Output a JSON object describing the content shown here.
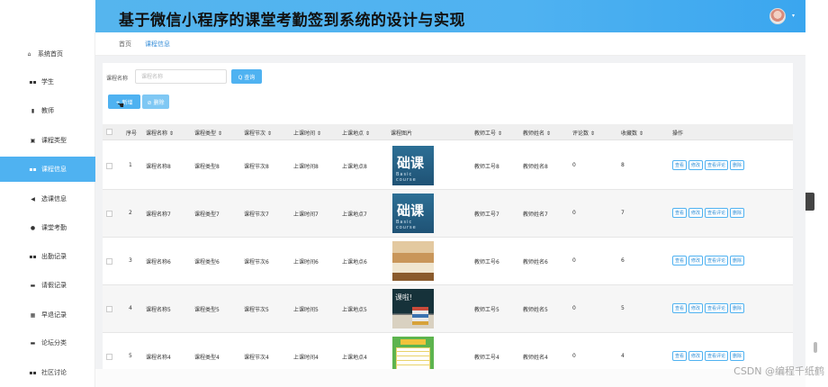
{
  "header": {
    "title": "基于微信小程序的课堂考勤签到系统的设计与实现",
    "caret": "▾"
  },
  "sidebar": {
    "items": [
      {
        "label": "系统首页",
        "icon": "home-icon",
        "glyph": "⌂"
      },
      {
        "label": "学生",
        "icon": "grid-icon",
        "glyph": "▪▪"
      },
      {
        "label": "教师",
        "icon": "chart-icon",
        "glyph": "▮"
      },
      {
        "label": "课程类型",
        "icon": "calendar-icon",
        "glyph": "▣"
      },
      {
        "label": "课程信息",
        "icon": "grid-icon",
        "glyph": "▪▪",
        "active": true
      },
      {
        "label": "选课信息",
        "icon": "send-icon",
        "glyph": "◀"
      },
      {
        "label": "课堂考勤",
        "icon": "location-icon",
        "glyph": "●"
      },
      {
        "label": "出勤记录",
        "icon": "grid-icon",
        "glyph": "▪▪"
      },
      {
        "label": "请假记录",
        "icon": "comment-icon",
        "glyph": "▬"
      },
      {
        "label": "早退记录",
        "icon": "table-icon",
        "glyph": "▦"
      },
      {
        "label": "论坛分类",
        "icon": "comment-icon",
        "glyph": "▬"
      },
      {
        "label": "社区讨论",
        "icon": "grid-icon",
        "glyph": "▪▪"
      }
    ]
  },
  "breadcrumb": {
    "home": "首页",
    "current": "课程信息"
  },
  "search": {
    "label": "课程名称",
    "placeholder": "课程名称",
    "query_label": "Q 查询"
  },
  "toolbar": {
    "add_label": "+ 新增",
    "delete_label": "⊘ 删除"
  },
  "table": {
    "headers": [
      "序号",
      "课程名称 ⇕",
      "课程类型 ⇕",
      "课程节次 ⇕",
      "上课时间 ⇕",
      "上课地点 ⇕",
      "课程图片",
      "教师工号 ⇕",
      "教师姓名 ⇕",
      "评论数 ⇕",
      "收藏数 ⇕",
      "操作"
    ],
    "actions": [
      "查看",
      "修改",
      "查看评论",
      "删除"
    ],
    "rows": [
      {
        "index": "1",
        "name": "课程名称8",
        "type": "课程类型8",
        "section": "课程节次8",
        "time": "上课时间8",
        "place": "上课地点8",
        "image": "blue",
        "image_text": "础课",
        "image_sub": "Basic course",
        "teacher_no": "教师工号8",
        "teacher_name": "教师姓名8",
        "comments": "0",
        "favorites": "8"
      },
      {
        "index": "2",
        "name": "课程名称7",
        "type": "课程类型7",
        "section": "课程节次7",
        "time": "上课时间7",
        "place": "上课地点7",
        "image": "blue",
        "image_text": "础课",
        "image_sub": "Basic course",
        "teacher_no": "教师工号7",
        "teacher_name": "教师姓名7",
        "comments": "0",
        "favorites": "7"
      },
      {
        "index": "3",
        "name": "课程名称6",
        "type": "课程类型6",
        "section": "课程节次6",
        "time": "上课时间6",
        "place": "上课地点6",
        "image": "books",
        "teacher_no": "教师工号6",
        "teacher_name": "教师姓名6",
        "comments": "0",
        "favorites": "6"
      },
      {
        "index": "4",
        "name": "课程名称5",
        "type": "课程类型5",
        "section": "课程节次5",
        "time": "上课时间5",
        "place": "上课地点5",
        "image": "board",
        "image_text": "课啦!",
        "teacher_no": "教师工号5",
        "teacher_name": "教师姓名5",
        "comments": "0",
        "favorites": "5"
      },
      {
        "index": "5",
        "name": "课程名称4",
        "type": "课程类型4",
        "section": "课程节次4",
        "time": "上课时间4",
        "place": "上课地点4",
        "image": "sched",
        "teacher_no": "教师工号4",
        "teacher_name": "教师姓名4",
        "comments": "0",
        "favorites": "4"
      }
    ]
  },
  "watermark": "CSDN @编程千纸鹤",
  "colors": {
    "accent": "#4fb2f1",
    "link": "#2f8fd6"
  }
}
